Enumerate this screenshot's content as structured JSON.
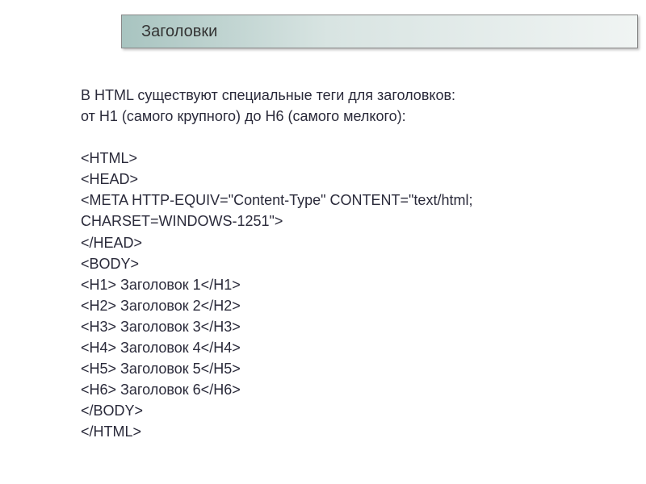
{
  "header": {
    "title": "Заголовки"
  },
  "intro": {
    "line1": "В HTML существуют специальные теги для заголовков:",
    "line2": "от H1 (самого крупного) до H6 (самого мелкого):"
  },
  "code": {
    "l1": "<HTML>",
    "l2": "<HEAD>",
    "l3": "<META HTTP-EQUIV=\"Content-Type\" CONTENT=\"text/html;",
    "l4": "CHARSET=WINDOWS-1251\">",
    "l5": "</HEAD>",
    "l6": "<BODY>",
    "l7": "<H1> Заголовок 1</H1>",
    "l8": "<H2> Заголовок 2</H2>",
    "l9": "<H3> Заголовок 3</H3>",
    "l10": "<H4> Заголовок 4</H4>",
    "l11": "<H5> Заголовок 5</H5>",
    "l12": "<H6> Заголовок 6</H6>",
    "l13": "</BODY>",
    "l14": "</HTML>"
  }
}
